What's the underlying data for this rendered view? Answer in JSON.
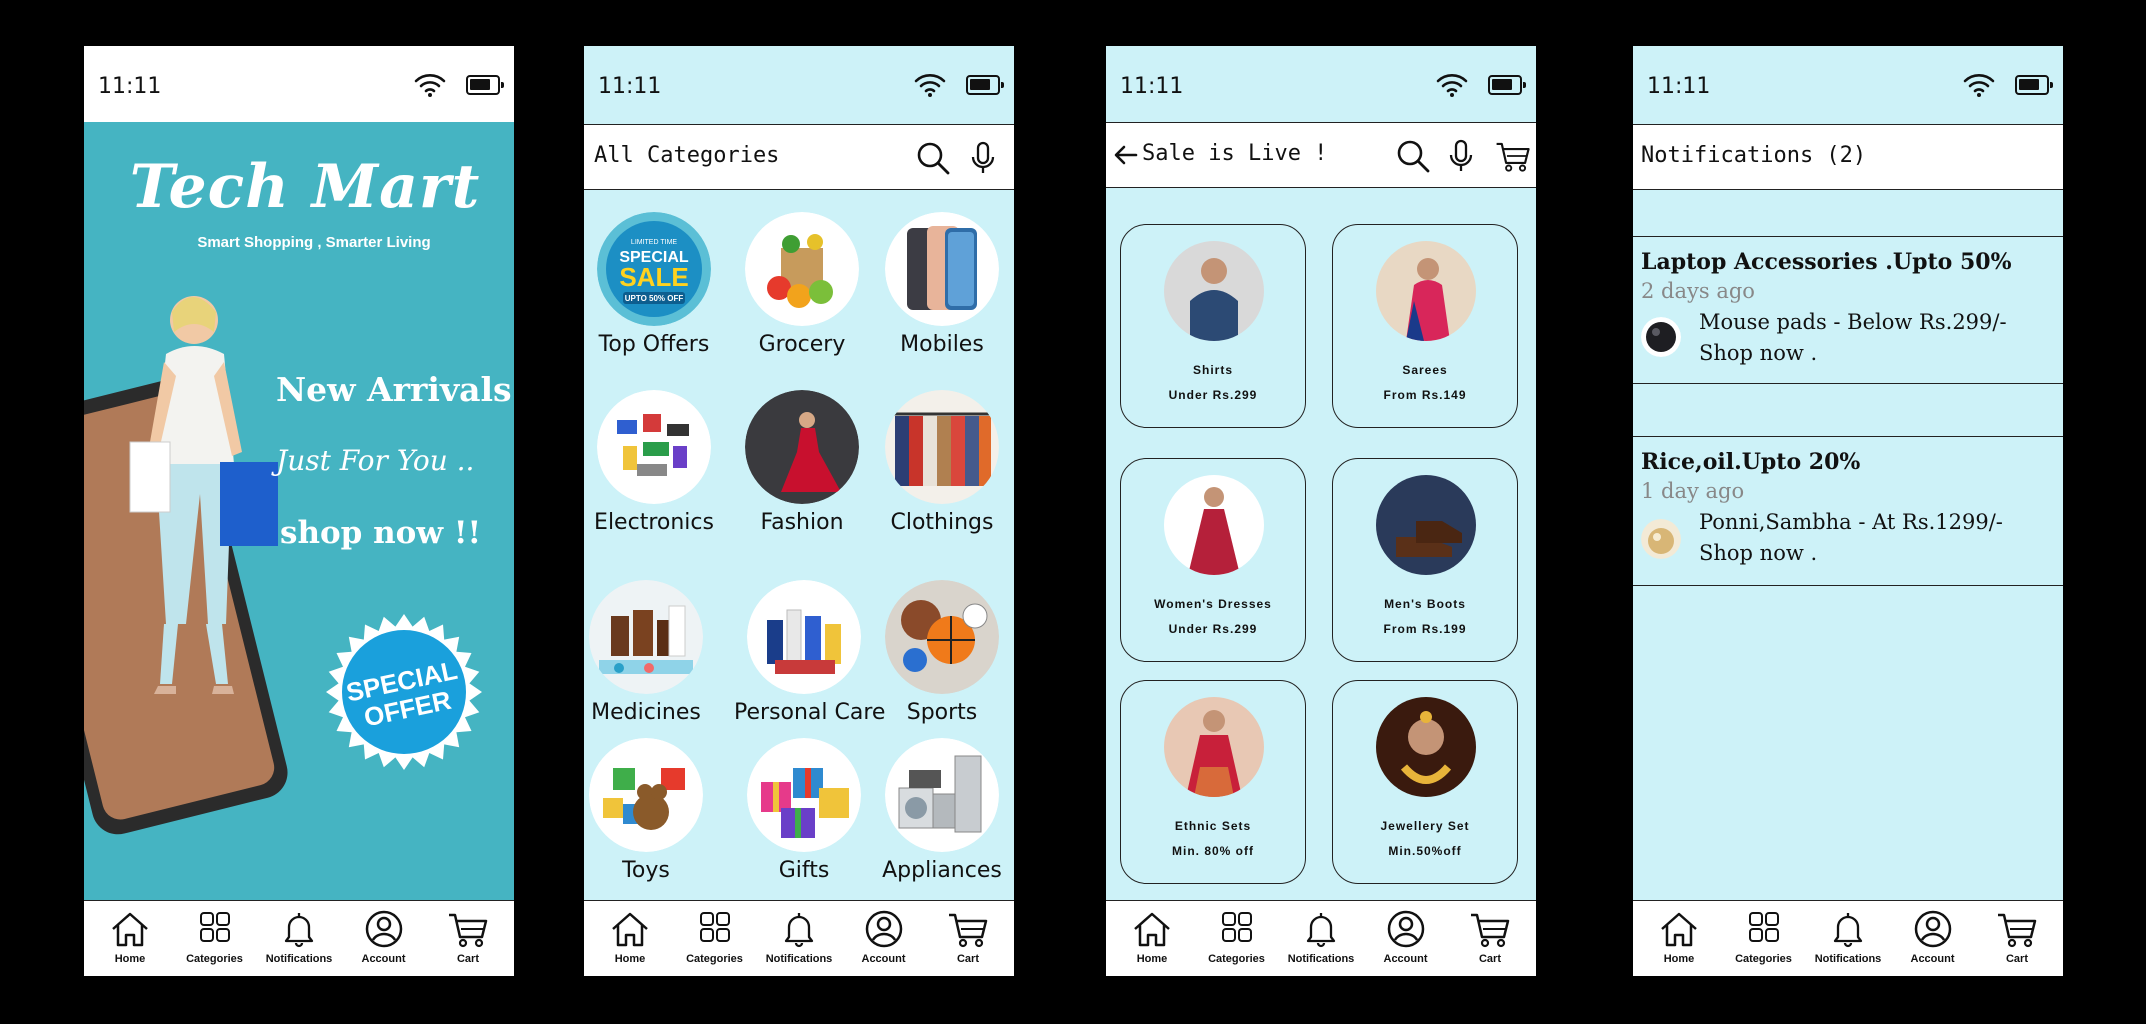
{
  "status": {
    "time": "11:11"
  },
  "nav": {
    "home": "Home",
    "categories": "Categories",
    "notifications": "Notifications",
    "account": "Account",
    "cart": "Cart"
  },
  "home": {
    "brand": "Tech Mart",
    "tagline": "Smart Shopping , Smarter Living",
    "new_arrivals": "New Arrivals",
    "just_for_you": "Just For You ..",
    "shop_now": "shop now !!",
    "badge": "SPECIAL OFFER"
  },
  "categories": {
    "title": "All Categories",
    "items": [
      {
        "label": "Top Offers",
        "icon": "special-sale"
      },
      {
        "label": "Grocery",
        "icon": "grocery-bag"
      },
      {
        "label": "Mobiles",
        "icon": "smartphones"
      },
      {
        "label": "Electronics",
        "icon": "electronics"
      },
      {
        "label": "Fashion",
        "icon": "red-dress"
      },
      {
        "label": "Clothings",
        "icon": "clothes-rack"
      },
      {
        "label": "Medicines",
        "icon": "medicine-bottles"
      },
      {
        "label": "Personal Care",
        "icon": "personal-care-products"
      },
      {
        "label": "Sports",
        "icon": "sports-balls"
      },
      {
        "label": "Toys",
        "icon": "toys"
      },
      {
        "label": "Gifts",
        "icon": "gift-boxes"
      },
      {
        "label": "Appliances",
        "icon": "home-appliances"
      }
    ],
    "sale_badge_small": "LIMITED TIME",
    "sale_badge_special": "SPECIAL",
    "sale_badge_sale": "SALE",
    "sale_badge_upto": "UPTO 50% OFF"
  },
  "sale": {
    "title": "Sale is Live !",
    "items": [
      {
        "name": "Shirts",
        "price": "Under Rs.299"
      },
      {
        "name": "Sarees",
        "price": "From Rs.149"
      },
      {
        "name": "Women's Dresses",
        "price": "Under Rs.299"
      },
      {
        "name": "Men's Boots",
        "price": "From Rs.199"
      },
      {
        "name": "Ethnic Sets",
        "price": "Min. 80% off"
      },
      {
        "name": "Jewellery Set",
        "price": "Min.50%off"
      }
    ]
  },
  "notifications": {
    "title": "Notifications (2)",
    "items": [
      {
        "title": "Laptop Accessories .Upto 50%",
        "time": "2 days ago",
        "line1": "Mouse pads - Below Rs.299/-",
        "line2": "Shop now ."
      },
      {
        "title": "Rice,oil.Upto 20%",
        "time": "1 day ago",
        "line1": "Ponni,Sambha - At Rs.1299/-",
        "line2": "Shop now ."
      }
    ]
  },
  "colors": {
    "hero": "#45b4c2",
    "pale": "#cdf2f8"
  }
}
